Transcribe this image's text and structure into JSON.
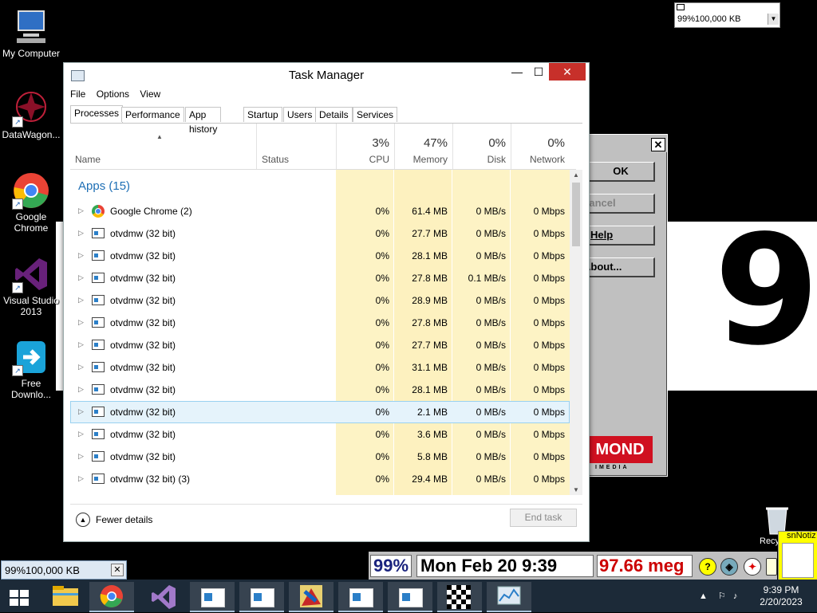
{
  "desktop": {
    "icons": [
      {
        "label": "My Computer"
      },
      {
        "label": "DataWagon..."
      },
      {
        "label": "Google Chrome"
      },
      {
        "label": "Visual Studio 2013"
      },
      {
        "label": "Free Downlo..."
      }
    ],
    "big_digit": "9"
  },
  "top_combo": {
    "value": "99%100,000 KB"
  },
  "dialog": {
    "buttons": [
      "OK",
      "Cancel",
      "Help",
      "About..."
    ],
    "logo": "MOND",
    "logo_sub": "IMEDIA"
  },
  "task_manager": {
    "title": "Task Manager",
    "window_buttons": {
      "minimize": "—",
      "maximize": "☐",
      "close": "✕"
    },
    "menu": [
      "File",
      "Options",
      "View"
    ],
    "tabs": [
      "Processes",
      "Performance",
      "App history",
      "Startup",
      "Users",
      "Details",
      "Services"
    ],
    "active_tab": "Processes",
    "headers": {
      "name": "Name",
      "status": "Status",
      "cpu": {
        "pct": "3%",
        "label": "CPU"
      },
      "memory": {
        "pct": "47%",
        "label": "Memory"
      },
      "disk": {
        "pct": "0%",
        "label": "Disk"
      },
      "network": {
        "pct": "0%",
        "label": "Network"
      }
    },
    "group_label": "Apps (15)",
    "rows": [
      {
        "name": "Google Chrome (2)",
        "icon": "chrome-icon",
        "cpu": "0%",
        "memory": "61.4 MB",
        "disk": "0 MB/s",
        "network": "0 Mbps"
      },
      {
        "name": "otvdmw (32 bit)",
        "icon": "window-app-icon",
        "cpu": "0%",
        "memory": "27.7 MB",
        "disk": "0 MB/s",
        "network": "0 Mbps"
      },
      {
        "name": "otvdmw (32 bit)",
        "icon": "window-app-icon",
        "cpu": "0%",
        "memory": "28.1 MB",
        "disk": "0 MB/s",
        "network": "0 Mbps"
      },
      {
        "name": "otvdmw (32 bit)",
        "icon": "window-app-icon",
        "cpu": "0%",
        "memory": "27.8 MB",
        "disk": "0.1 MB/s",
        "network": "0 Mbps"
      },
      {
        "name": "otvdmw (32 bit)",
        "icon": "window-app-icon",
        "cpu": "0%",
        "memory": "28.9 MB",
        "disk": "0 MB/s",
        "network": "0 Mbps"
      },
      {
        "name": "otvdmw (32 bit)",
        "icon": "window-app-icon",
        "cpu": "0%",
        "memory": "27.8 MB",
        "disk": "0 MB/s",
        "network": "0 Mbps"
      },
      {
        "name": "otvdmw (32 bit)",
        "icon": "window-app-icon",
        "cpu": "0%",
        "memory": "27.7 MB",
        "disk": "0 MB/s",
        "network": "0 Mbps"
      },
      {
        "name": "otvdmw (32 bit)",
        "icon": "window-app-icon",
        "cpu": "0%",
        "memory": "31.1 MB",
        "disk": "0 MB/s",
        "network": "0 Mbps"
      },
      {
        "name": "otvdmw (32 bit)",
        "icon": "window-app-icon",
        "cpu": "0%",
        "memory": "28.1 MB",
        "disk": "0 MB/s",
        "network": "0 Mbps"
      },
      {
        "name": "otvdmw (32 bit)",
        "icon": "window-app-icon",
        "cpu": "0%",
        "memory": "2.1 MB",
        "disk": "0 MB/s",
        "network": "0 Mbps",
        "selected": true
      },
      {
        "name": "otvdmw (32 bit)",
        "icon": "window-app-icon",
        "cpu": "0%",
        "memory": "3.6 MB",
        "disk": "0 MB/s",
        "network": "0 Mbps"
      },
      {
        "name": "otvdmw (32 bit)",
        "icon": "window-app-icon",
        "cpu": "0%",
        "memory": "5.8 MB",
        "disk": "0 MB/s",
        "network": "0 Mbps"
      },
      {
        "name": "otvdmw (32 bit) (3)",
        "icon": "window-app-icon",
        "cpu": "0%",
        "memory": "29.4 MB",
        "disk": "0 MB/s",
        "network": "0 Mbps"
      }
    ],
    "footer": {
      "fewer_details": "Fewer details",
      "end_task": "End task"
    },
    "colors": {
      "heat": "#fdf3c5",
      "group": "#1e6fb5",
      "close": "#c7302a"
    }
  },
  "bottom_combo": {
    "value": "99%100,000 KB",
    "close": "✕"
  },
  "status_strip": {
    "percent": "99%",
    "datetime": "Mon Feb 20 9:39",
    "memory": "97.66 meg",
    "memory_color": "#cc0000",
    "percent_color": "#1a237e"
  },
  "notiz": {
    "label": "snNotiz"
  },
  "recycle": {
    "label": "Recyc"
  },
  "taskbar": {
    "buttons": [
      "windows-start-icon",
      "file-explorer-icon",
      "chrome-icon",
      "visual-studio-icon",
      "app-window-icon",
      "app-window-icon",
      "paint-icon",
      "app-window-icon",
      "app-window-icon",
      "checkered-icon",
      "task-manager-icon"
    ],
    "time": "9:39 PM",
    "date": "2/20/2023",
    "tray_arrow": "▲"
  }
}
